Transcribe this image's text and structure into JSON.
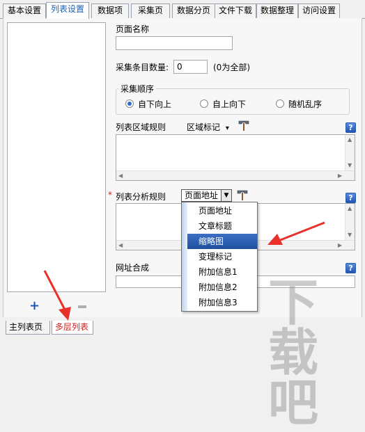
{
  "tabs": [
    "基本设置",
    "列表设置",
    "数据项",
    "采集页",
    "数据分页",
    "文件下载",
    "数据整理",
    "访问设置"
  ],
  "active_tab": "列表设置",
  "form": {
    "page_name_label": "页面名称",
    "page_name_value": "",
    "item_count_label": "采集条目数量:",
    "item_count_value": "0",
    "item_count_hint": "(0为全部)",
    "order_group_title": "采集顺序",
    "order_options": [
      {
        "label": "自下向上",
        "checked": true
      },
      {
        "label": "自上向下",
        "checked": false
      },
      {
        "label": "随机乱序",
        "checked": false
      }
    ],
    "area_rule_label": "列表区域规则",
    "area_mark_label": "区域标记",
    "area_mark_arrow": "▾",
    "required_star": "*",
    "analysis_rule_label": "列表分析规则",
    "analysis_combo_value": "页面地址",
    "analysis_combo_arrow": "▼",
    "url_compose_label": "网址合成",
    "help_glyph": "?"
  },
  "dropdown_options": [
    "页面地址",
    "文章标题",
    "缩略图",
    "变理标记",
    "附加信息1",
    "附加信息2",
    "附加信息3"
  ],
  "dropdown_selected": "缩略图",
  "bottom_tabs": [
    "主列表页",
    "多层列表"
  ],
  "bottom_active": "多层列表",
  "buttons": {
    "add": "+"
  },
  "colors": {
    "accent": "#1f55b5",
    "selected": "#2d5fb0",
    "annotation_arrow": "#e8312b"
  }
}
